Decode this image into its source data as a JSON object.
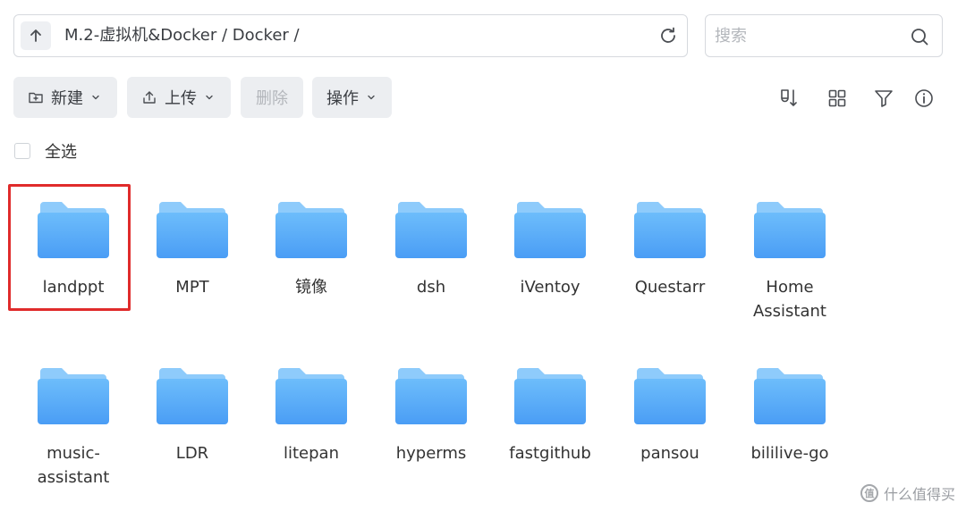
{
  "pathbar": {
    "path": "M.2-虚拟机&Docker / Docker /"
  },
  "search": {
    "placeholder": "搜索"
  },
  "toolbar": {
    "new_label": "新建",
    "upload_label": "上传",
    "delete_label": "删除",
    "actions_label": "操作"
  },
  "selection": {
    "select_all_label": "全选"
  },
  "folders": [
    {
      "name": "landppt",
      "selected": true
    },
    {
      "name": "MPT"
    },
    {
      "name": "镜像"
    },
    {
      "name": "dsh"
    },
    {
      "name": "iVentoy"
    },
    {
      "name": "Questarr"
    },
    {
      "name": "Home Assistant"
    },
    {
      "name": "music-assistant"
    },
    {
      "name": "LDR"
    },
    {
      "name": "litepan"
    },
    {
      "name": "hyperms"
    },
    {
      "name": "fastgithub"
    },
    {
      "name": "pansou"
    },
    {
      "name": "bililive-go"
    }
  ],
  "watermark": {
    "text": "什么值得买",
    "logo": "值"
  },
  "colors": {
    "highlight": "#e02b2b",
    "folder": "#5aabf6",
    "folder_tab": "#8ecbfb"
  },
  "icons": [
    "arrow-up-icon",
    "refresh-icon",
    "search-icon",
    "new-folder-icon",
    "upload-icon",
    "chevron-down-icon",
    "sort-icon",
    "grid-view-icon",
    "filter-icon",
    "info-icon",
    "folder-icon"
  ]
}
